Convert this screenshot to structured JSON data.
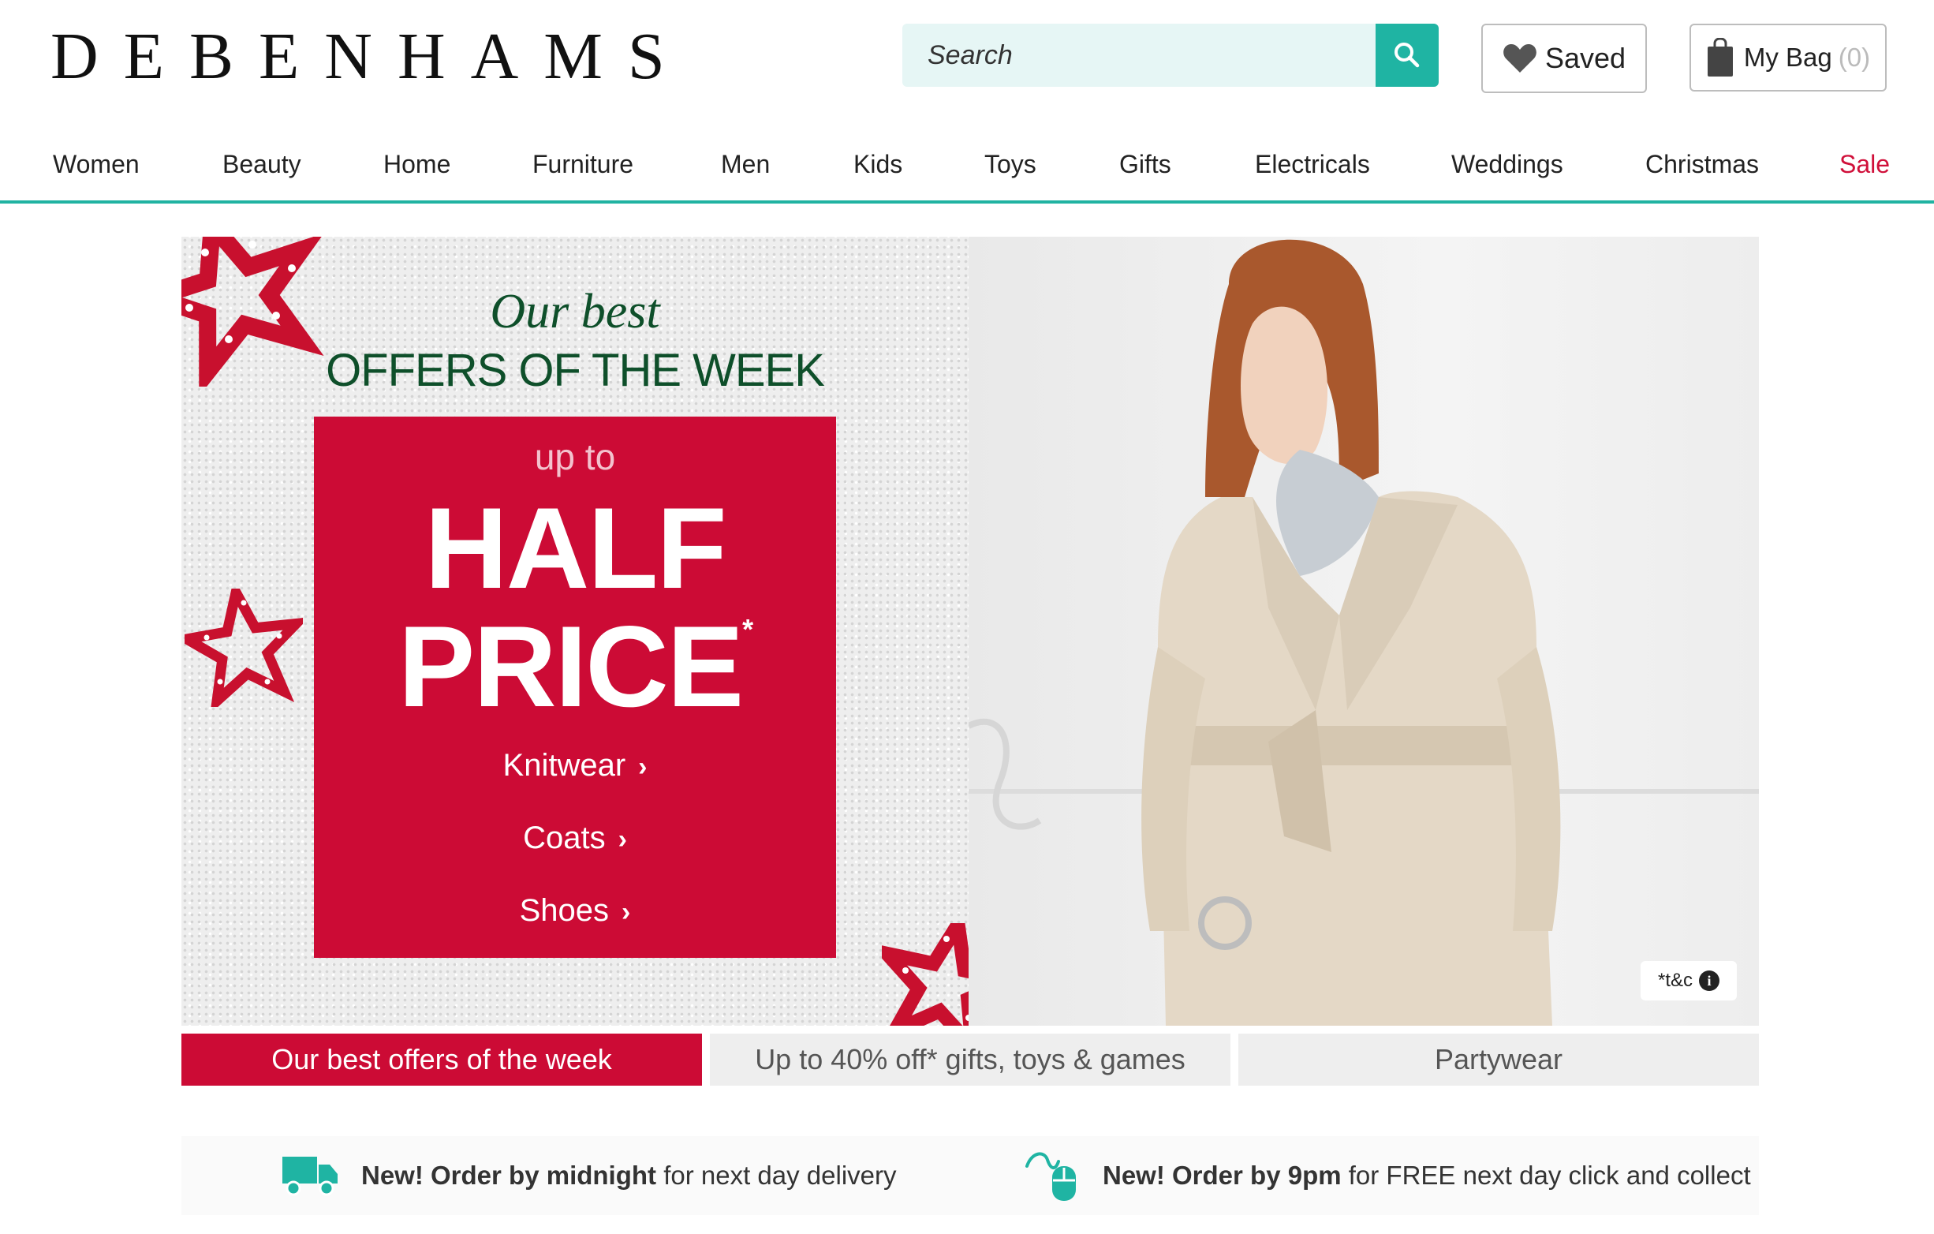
{
  "header": {
    "logo": "DEBENHAMS",
    "search_placeholder": "Search",
    "saved_label": "Saved",
    "bag_label": "My Bag",
    "bag_count": "(0)"
  },
  "nav": {
    "items": [
      "Women",
      "Beauty",
      "Home",
      "Furniture",
      "Men",
      "Kids",
      "Toys",
      "Gifts",
      "Electricals",
      "Weddings",
      "Christmas",
      "Sale"
    ]
  },
  "hero": {
    "headline_italic": "Our best",
    "headline_caps": "OFFERS OF THE WEEK",
    "offer_prefix": "up to",
    "offer_line1": "HALF",
    "offer_line2": "PRICE",
    "offer_asterisk": "*",
    "links": [
      "Knitwear",
      "Coats",
      "Shoes"
    ],
    "terms_label": "*t&c"
  },
  "tabs": [
    "Our best offers of the week",
    "Up to 40% off* gifts, toys & games",
    "Partywear"
  ],
  "delivery": {
    "item1_bold": "New! Order by midnight",
    "item1_rest": " for next day delivery",
    "item2_bold": "New! Order by 9pm",
    "item2_rest": " for FREE next day click and collect"
  },
  "colors": {
    "brand_teal": "#1fb4a3",
    "sale_red": "#d0103a",
    "offer_red": "#cc0b35",
    "headline_green": "#0e4f2a"
  }
}
